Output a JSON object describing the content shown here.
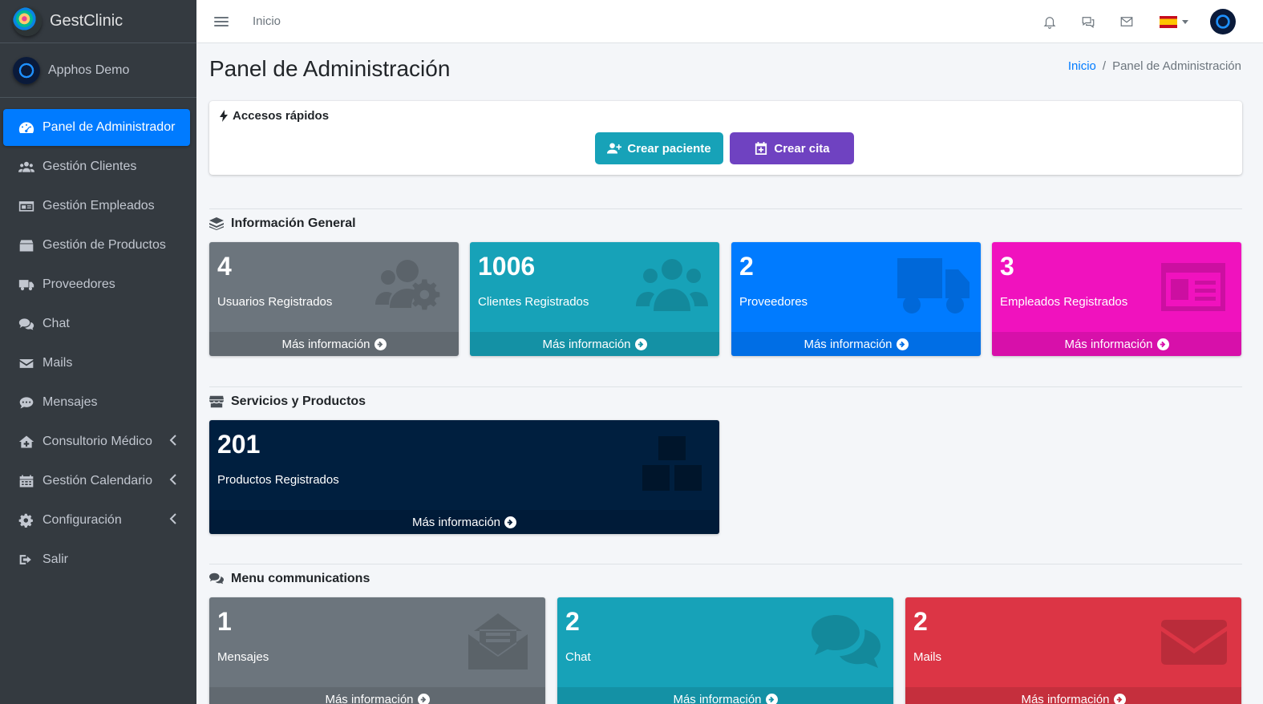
{
  "brand": {
    "name": "GestClinic"
  },
  "user": {
    "name": "Apphos Demo"
  },
  "sidebar": {
    "items": [
      {
        "label": "Panel de Administrador",
        "icon": "dashboard-icon",
        "active": true
      },
      {
        "label": "Gestión Clientes",
        "icon": "users-icon"
      },
      {
        "label": "Gestión Empleados",
        "icon": "id-card-icon"
      },
      {
        "label": "Gestión de Productos",
        "icon": "box-icon"
      },
      {
        "label": "Proveedores",
        "icon": "truck-icon"
      },
      {
        "label": "Chat",
        "icon": "chat-icon"
      },
      {
        "label": "Mails",
        "icon": "mail-icon"
      },
      {
        "label": "Mensajes",
        "icon": "comment-icon"
      },
      {
        "label": "Consultorio Médico",
        "icon": "clinic-icon",
        "expandable": true
      },
      {
        "label": "Gestión Calendario",
        "icon": "calendar-icon",
        "expandable": true
      },
      {
        "label": "Configuración",
        "icon": "gear-icon",
        "expandable": true
      },
      {
        "label": "Salir",
        "icon": "logout-icon"
      }
    ]
  },
  "topbar": {
    "home_link": "Inicio",
    "language": "es"
  },
  "page": {
    "title": "Panel de Administración",
    "breadcrumb": {
      "home": "Inicio",
      "separator": "/",
      "current": "Panel de Administración"
    }
  },
  "quick_access": {
    "title": "Accesos rápidos",
    "create_patient": "Crear paciente",
    "create_appointment": "Crear cita"
  },
  "sections": {
    "general": "Información General",
    "services": "Servicios y Productos",
    "communications": "Menu communications"
  },
  "more_info": "Más información",
  "stats": {
    "users": {
      "value": "4",
      "label": "Usuarios Registrados",
      "color": "#6c757d"
    },
    "clients": {
      "value": "1006",
      "label": "Clientes Registrados",
      "color": "#17a2b8"
    },
    "suppliers": {
      "value": "2",
      "label": "Proveedores",
      "color": "#007bff"
    },
    "employees": {
      "value": "3",
      "label": "Empleados Registrados",
      "color": "#f012be"
    },
    "products": {
      "value": "201",
      "label": "Productos Registrados",
      "color": "#001f3f"
    },
    "messages": {
      "value": "1",
      "label": "Mensajes",
      "color": "#6c757d"
    },
    "chat": {
      "value": "2",
      "label": "Chat",
      "color": "#17a2b8"
    },
    "mails": {
      "value": "2",
      "label": "Mails",
      "color": "#dc3545"
    }
  }
}
